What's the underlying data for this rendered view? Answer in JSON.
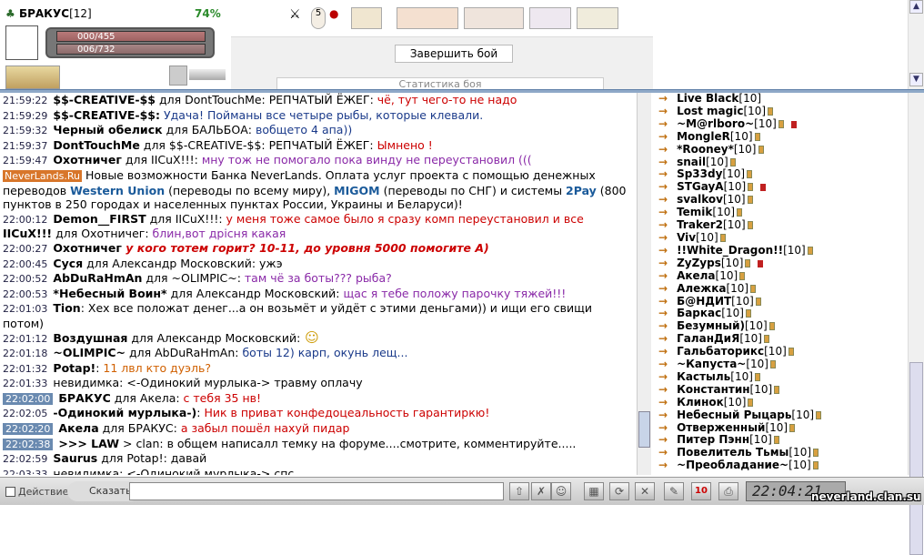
{
  "character": {
    "name": "БРАКУС",
    "level": "[12]",
    "percent": "74%",
    "hp": "000/455",
    "mp": "006/732"
  },
  "battle": {
    "end_button": "Завершить бой",
    "stats_tab": "Статистика боя"
  },
  "chat": [
    {
      "time": "21:59:22",
      "who": "$$-CREATIVE-$$",
      "for": " для DontTouchMe: РЕПЧАТЫЙ ЁЖЕГ:",
      "msg": " чё, тут чего-то не надо",
      "cls": "m-red"
    },
    {
      "time": "21:59:29",
      "who": "$$-CREATIVE-$$:",
      "for": "",
      "msg": " Удача! Пойманы все четыре рыбы, которые клевали.",
      "cls": "m-blue"
    },
    {
      "time": "21:59:32",
      "who": "Черный обелиск",
      "for": " для БАЛЬБОА:",
      "msg": " вобщето 4 апа))",
      "cls": "m-blue"
    },
    {
      "time": "21:59:37",
      "who": "DontTouchMe",
      "for": " для $$-CREATIVE-$$: РЕПЧАТЫЙ ЁЖЕГ:",
      "msg": " Ымнено !",
      "cls": "m-red"
    },
    {
      "time": "21:59:47",
      "who": "Охотничег",
      "for": " для IICuX!!!:",
      "msg": " мну тож не помогало пока винду не переустановил (((",
      "cls": "m-purple"
    },
    {
      "time": "22:00:12",
      "who": "Demon__FIRST",
      "for": " для IICuX!!!:",
      "msg": " у меня тоже самое было я сразу комп переустановил и все",
      "cls": "m-red"
    },
    {
      "time": "",
      "who": "IICuX!!!",
      "for": " для Охотничег:",
      "msg": " блин,вот дрісня какая",
      "cls": "m-purple"
    },
    {
      "time": "22:00:27",
      "who": "Охотничег",
      "for": "",
      "msg": " у кого тотем горит? 10-11, до уровня 5000 помогите А)",
      "cls": "m-redb"
    },
    {
      "time": "22:00:45",
      "who": "Суся",
      "for": " для Александр Московский:",
      "msg": " ужэ",
      "cls": ""
    },
    {
      "time": "22:00:52",
      "who": "AbDuRaHmAn",
      "for": " для ~OLIMPIC~:",
      "msg": " там чё за боты??? рыба?",
      "cls": "m-purple"
    },
    {
      "time": "22:00:53",
      "who": "*Небесный Воин*",
      "for": " для Александр Московский:",
      "msg": " щас я тебе положу парочку тяжей!!!",
      "cls": "m-purple"
    },
    {
      "time": "22:01:03",
      "who": "Tion",
      "for": ":",
      "msg": " Хех все положат денег...а он возьмёт и уйдёт с этими деньгами)) и ищи его свищи потом)",
      "cls": "",
      "wrap": true
    },
    {
      "time": "22:01:12",
      "who": "Воздушная",
      "for": " для Александр Московский:",
      "msg": "",
      "cls": "",
      "smile": true
    },
    {
      "time": "22:01:18",
      "who": "~OLIMPIC~",
      "for": " для AbDuRaHmAn:",
      "msg": " боты 12) карп, окунь лещ...",
      "cls": "m-blue"
    },
    {
      "time": "22:01:32",
      "who": "Potap!",
      "for": ":",
      "msg": " 11 лвл кто дуэль?",
      "cls": "m-orange"
    },
    {
      "time": "22:01:33",
      "who": "",
      "for": "невидимка: <-Одинокий мурлыка->",
      "msg": " травму оплачу",
      "cls": ""
    },
    {
      "time": "22:02:00",
      "who": "БРАКУС",
      "for": " для Акела:",
      "msg": " с тебя 35 нв!",
      "cls": "m-red",
      "hl": true
    },
    {
      "time": "22:02:05",
      "who": "-Одинокий мурлыка-)",
      "for": ":",
      "msg": " Ник в приват конфедоцеальность гарантиркю!",
      "cls": "m-red"
    },
    {
      "time": "22:02:20",
      "who": "Акела",
      "for": " для БРАКУС:",
      "msg": " а забыл пошёл нахуй пидар",
      "cls": "m-red",
      "hl": true
    },
    {
      "time": "22:02:38",
      "who": ">>> LAW",
      "for": " > clan: в общем написалл темку на форуме....смотрите, комментируйте.....",
      "msg": "",
      "cls": "",
      "hl": true
    },
    {
      "time": "22:02:59",
      "who": "Saurus",
      "for": " для Potap!: давай",
      "msg": "",
      "cls": ""
    },
    {
      "time": "22:03:33",
      "who": "",
      "for": "невидимка: <-Одинокий мурлыка->",
      "msg": " спс",
      "cls": ""
    }
  ],
  "news": {
    "badge": "NeverLands.Ru",
    "text1": " Новые возможности Банка NeverLands. Оплата услуг проекта с помощью денежных переводов ",
    "wu": "Western Union",
    "text2": " (переводы по всему миру), ",
    "migom": "MIGOM",
    "text3": " (переводы по СНГ) и системы ",
    "pay": "2Pay",
    "text4": " (800 пунктов в 250 городах и населенных пунктах России, Украины и Беларуси)!"
  },
  "users": [
    {
      "name": "Live Black",
      "lvl": "[10]",
      "mini": false,
      "flag": false
    },
    {
      "name": "Lost magic",
      "lvl": "[10]",
      "mini": true,
      "flag": false
    },
    {
      "name": "~M@rlboro~",
      "lvl": "[10]",
      "mini": true,
      "flag": true
    },
    {
      "name": "MongleR",
      "lvl": "[10]",
      "mini": true,
      "flag": false
    },
    {
      "name": "*Rooney*",
      "lvl": "[10]",
      "mini": true,
      "flag": false
    },
    {
      "name": "snail",
      "lvl": "[10]",
      "mini": true,
      "flag": false
    },
    {
      "name": "Sp33dy",
      "lvl": "[10]",
      "mini": true,
      "flag": false
    },
    {
      "name": "STGayA",
      "lvl": "[10]",
      "mini": true,
      "flag": true
    },
    {
      "name": "svalkov",
      "lvl": "[10]",
      "mini": true,
      "flag": false
    },
    {
      "name": "Temik",
      "lvl": "[10]",
      "mini": true,
      "flag": false
    },
    {
      "name": "Traker2",
      "lvl": "[10]",
      "mini": true,
      "flag": false
    },
    {
      "name": "Viv",
      "lvl": "[10]",
      "mini": true,
      "flag": false
    },
    {
      "name": "!!White_Dragon!!",
      "lvl": "[10]",
      "mini": true,
      "flag": false
    },
    {
      "name": "ZyZyps",
      "lvl": "[10]",
      "mini": true,
      "flag": true
    },
    {
      "name": "Акела",
      "lvl": "[10]",
      "mini": true,
      "flag": false
    },
    {
      "name": "Алежка",
      "lvl": "[10]",
      "mini": true,
      "flag": false
    },
    {
      "name": "Б@НДИТ",
      "lvl": "[10]",
      "mini": true,
      "flag": false
    },
    {
      "name": "Баркас",
      "lvl": "[10]",
      "mini": true,
      "flag": false
    },
    {
      "name": "Безумный)",
      "lvl": "[10]",
      "mini": true,
      "flag": false
    },
    {
      "name": "ГаланДиЯ",
      "lvl": "[10]",
      "mini": true,
      "flag": false
    },
    {
      "name": "Гальбаторикс",
      "lvl": "[10]",
      "mini": true,
      "flag": false
    },
    {
      "name": "~Капуста~",
      "lvl": "[10]",
      "mini": true,
      "flag": false
    },
    {
      "name": "Кастыль",
      "lvl": "[10]",
      "mini": true,
      "flag": false
    },
    {
      "name": "Константин",
      "lvl": "[10]",
      "mini": true,
      "flag": false
    },
    {
      "name": "Клинок",
      "lvl": "[10]",
      "mini": true,
      "flag": false
    },
    {
      "name": "Небесный Рыцарь",
      "lvl": "[10]",
      "mini": true,
      "flag": false
    },
    {
      "name": "Отверженный",
      "lvl": "[10]",
      "mini": true,
      "flag": false
    },
    {
      "name": "Питер Пэнн",
      "lvl": "[10]",
      "mini": true,
      "flag": false
    },
    {
      "name": "Повелитель Тьмы",
      "lvl": "[10]",
      "mini": true,
      "flag": false
    },
    {
      "name": "~Преобладание~",
      "lvl": "[10]",
      "mini": true,
      "flag": false
    }
  ],
  "bottom": {
    "action": "Действие",
    "say": "Сказать:",
    "clock": "22:04:21",
    "site": "neverland.clan.su",
    "counter": "10"
  }
}
